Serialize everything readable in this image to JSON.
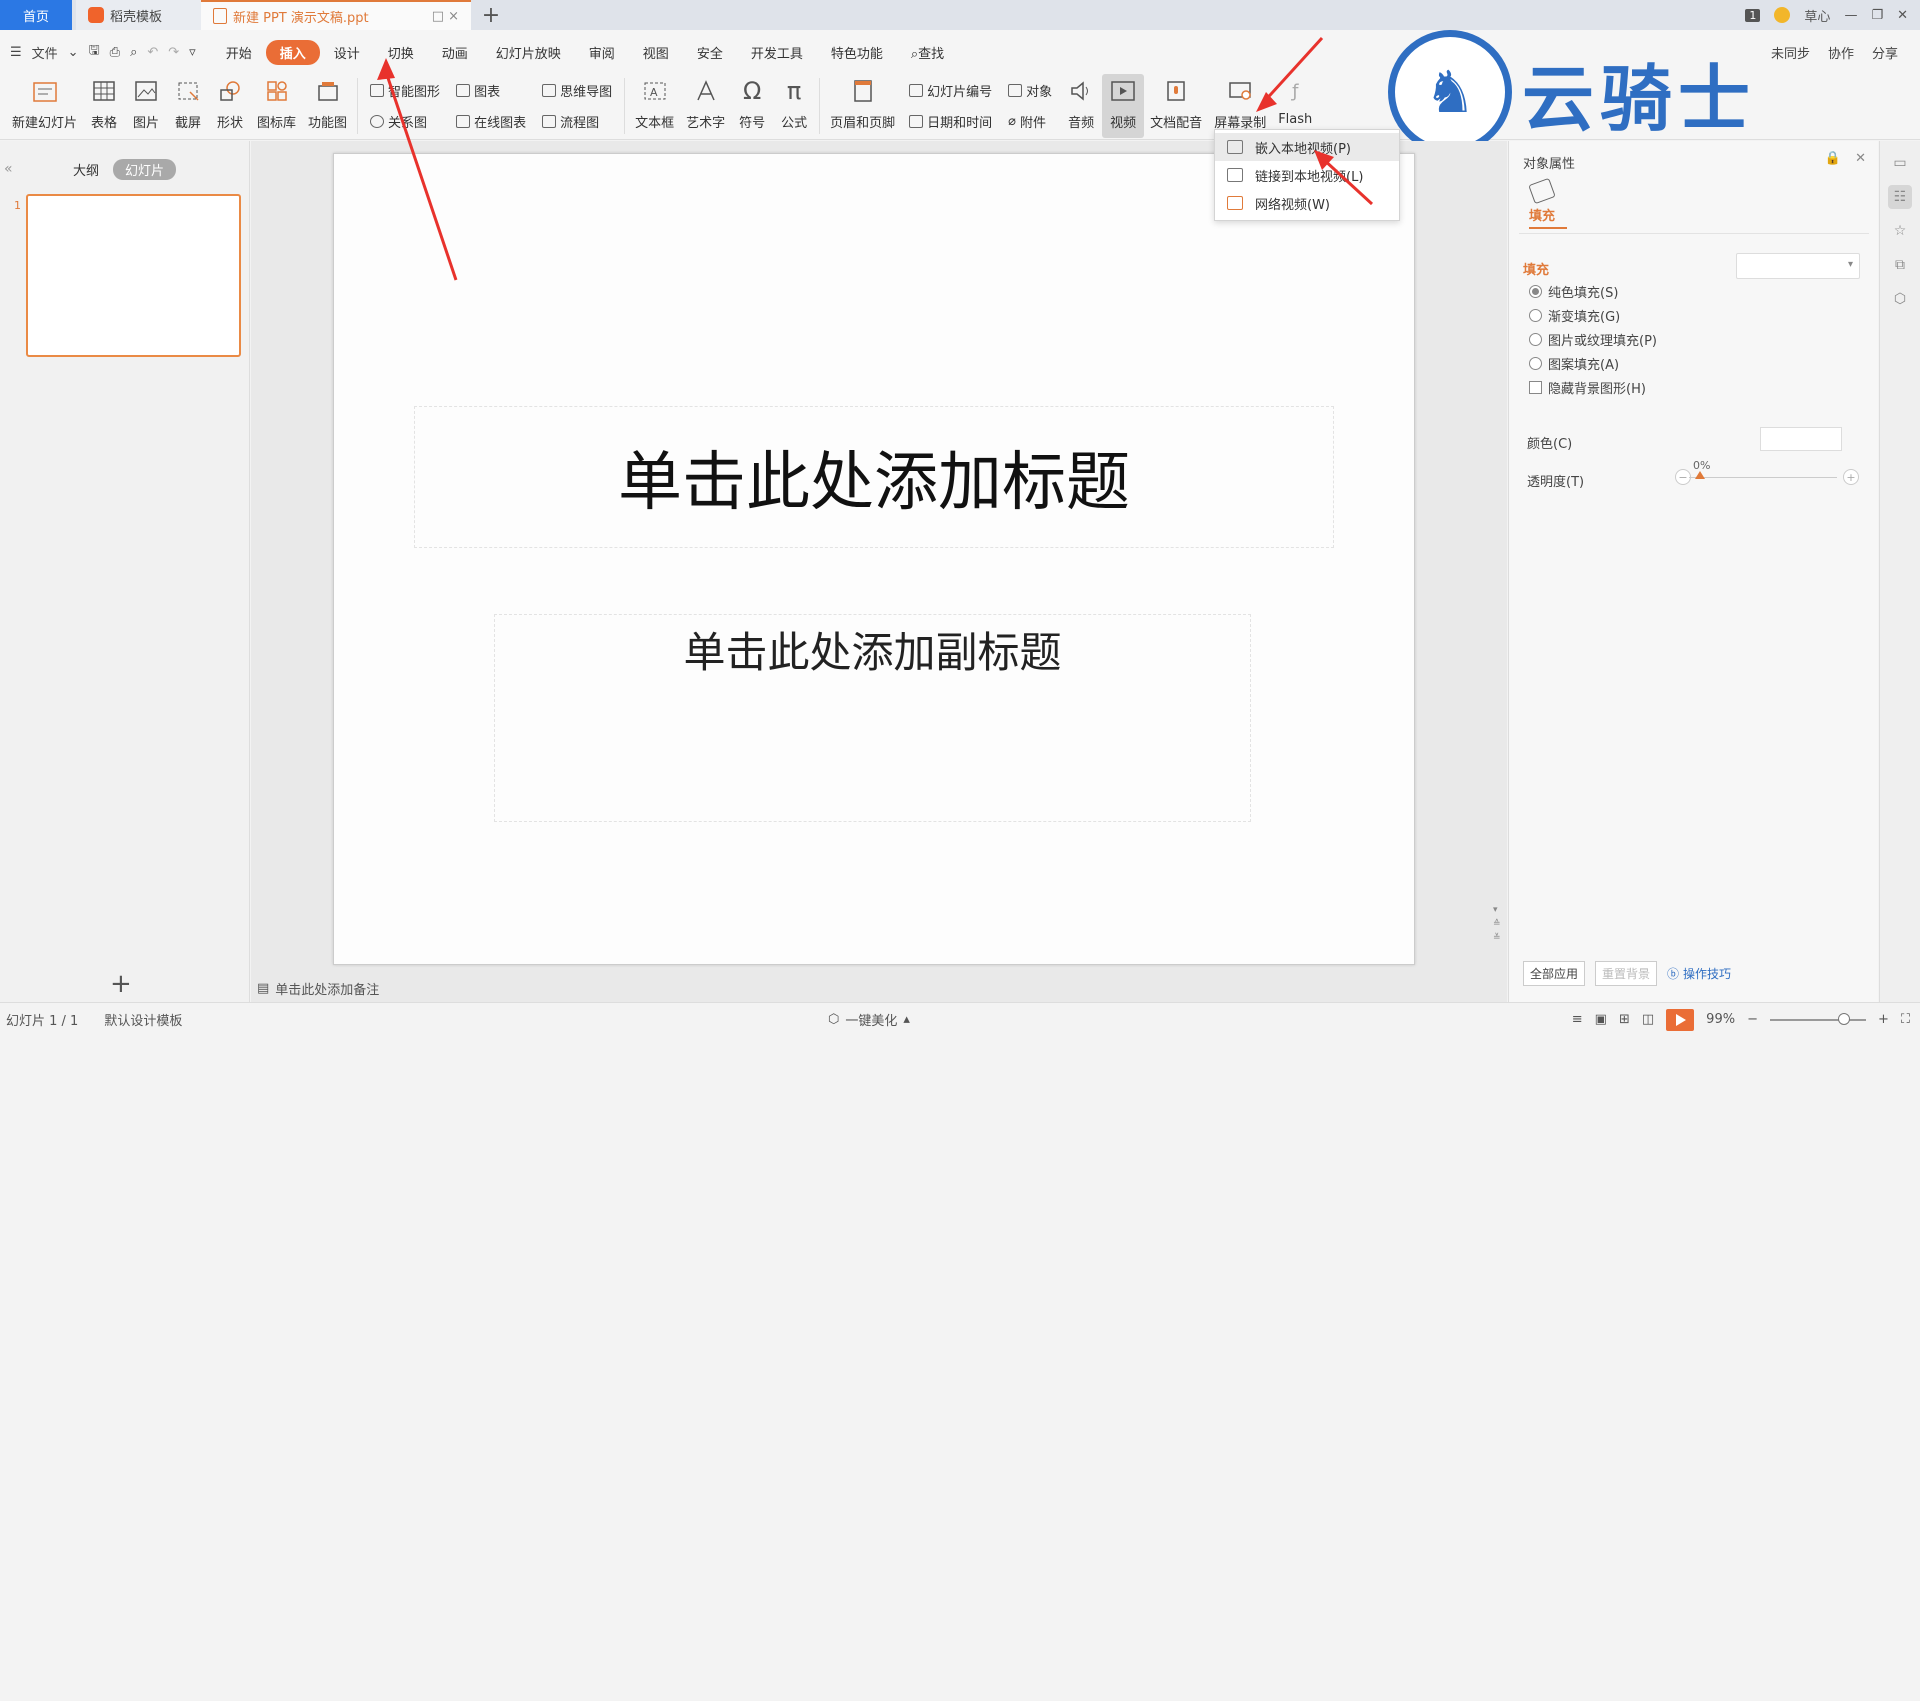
{
  "tabs": {
    "home": "首页",
    "rice": "稻壳模板",
    "doc": "新建 PPT 演示文稿.ppt",
    "doc_controls": "□ ×",
    "new_tab": "+"
  },
  "window": {
    "badge": "1",
    "user": "草心",
    "minimize": "—",
    "restore": "❐",
    "close": "✕"
  },
  "menubar": {
    "file": "文件",
    "tabs": [
      "开始",
      "插入",
      "设计",
      "切换",
      "动画",
      "幻灯片放映",
      "审阅",
      "视图",
      "安全",
      "开发工具",
      "特色功能",
      "查找"
    ],
    "active_tab": "插入",
    "right": [
      "未同步",
      "协作",
      "分享"
    ]
  },
  "ribbon": {
    "new_slide": "新建幻灯片",
    "table": "表格",
    "picture": "图片",
    "screenshot": "截屏",
    "shape": "形状",
    "icon_lib": "图标库",
    "func_chart": "功能图",
    "smart_shape": "智能图形",
    "chart": "图表",
    "relation": "关系图",
    "online_chart": "在线图表",
    "mindmap": "思维导图",
    "flowchart": "流程图",
    "textbox": "文本框",
    "wordart": "艺术字",
    "symbol": "符号",
    "formula": "公式",
    "header_footer": "页眉和页脚",
    "slide_number": "幻灯片编号",
    "object": "对象",
    "datetime": "日期和时间",
    "attachment": "附件",
    "audio": "音频",
    "video": "视频",
    "doc_voice": "文档配音",
    "screen_record": "屏幕录制",
    "flash": "Flash"
  },
  "video_menu": {
    "items": [
      "嵌入本地视频(P)",
      "链接到本地视频(L)",
      "网络视频(W)"
    ]
  },
  "watermark": {
    "text": "云骑士"
  },
  "left_panel": {
    "tab_outline": "大纲",
    "tab_slides": "幻灯片",
    "slide_number": "1",
    "add": "+"
  },
  "slide": {
    "title_placeholder": "单击此处添加标题",
    "subtitle_placeholder": "单击此处添加副标题",
    "notes_placeholder": "单击此处添加备注"
  },
  "right_panel": {
    "title": "对象属性",
    "fill_tab": "填充",
    "section": "填充",
    "options": [
      "纯色填充(S)",
      "渐变填充(G)",
      "图片或纹理填充(P)",
      "图案填充(A)"
    ],
    "hide_bg": "隐藏背景图形(H)",
    "color_label": "颜色(C)",
    "transparency_label": "透明度(T)",
    "transparency_value": "0%",
    "apply_all": "全部应用",
    "reset_bg": "重置背景",
    "tips": "操作技巧"
  },
  "status": {
    "slide_count": "幻灯片 1 / 1",
    "template": "默认设计模板",
    "beautify": "一键美化",
    "zoom": "99%"
  },
  "colors": {
    "accent": "#ea6d36",
    "arrow": "#e8322c",
    "watermark": "#2f6ec2"
  }
}
